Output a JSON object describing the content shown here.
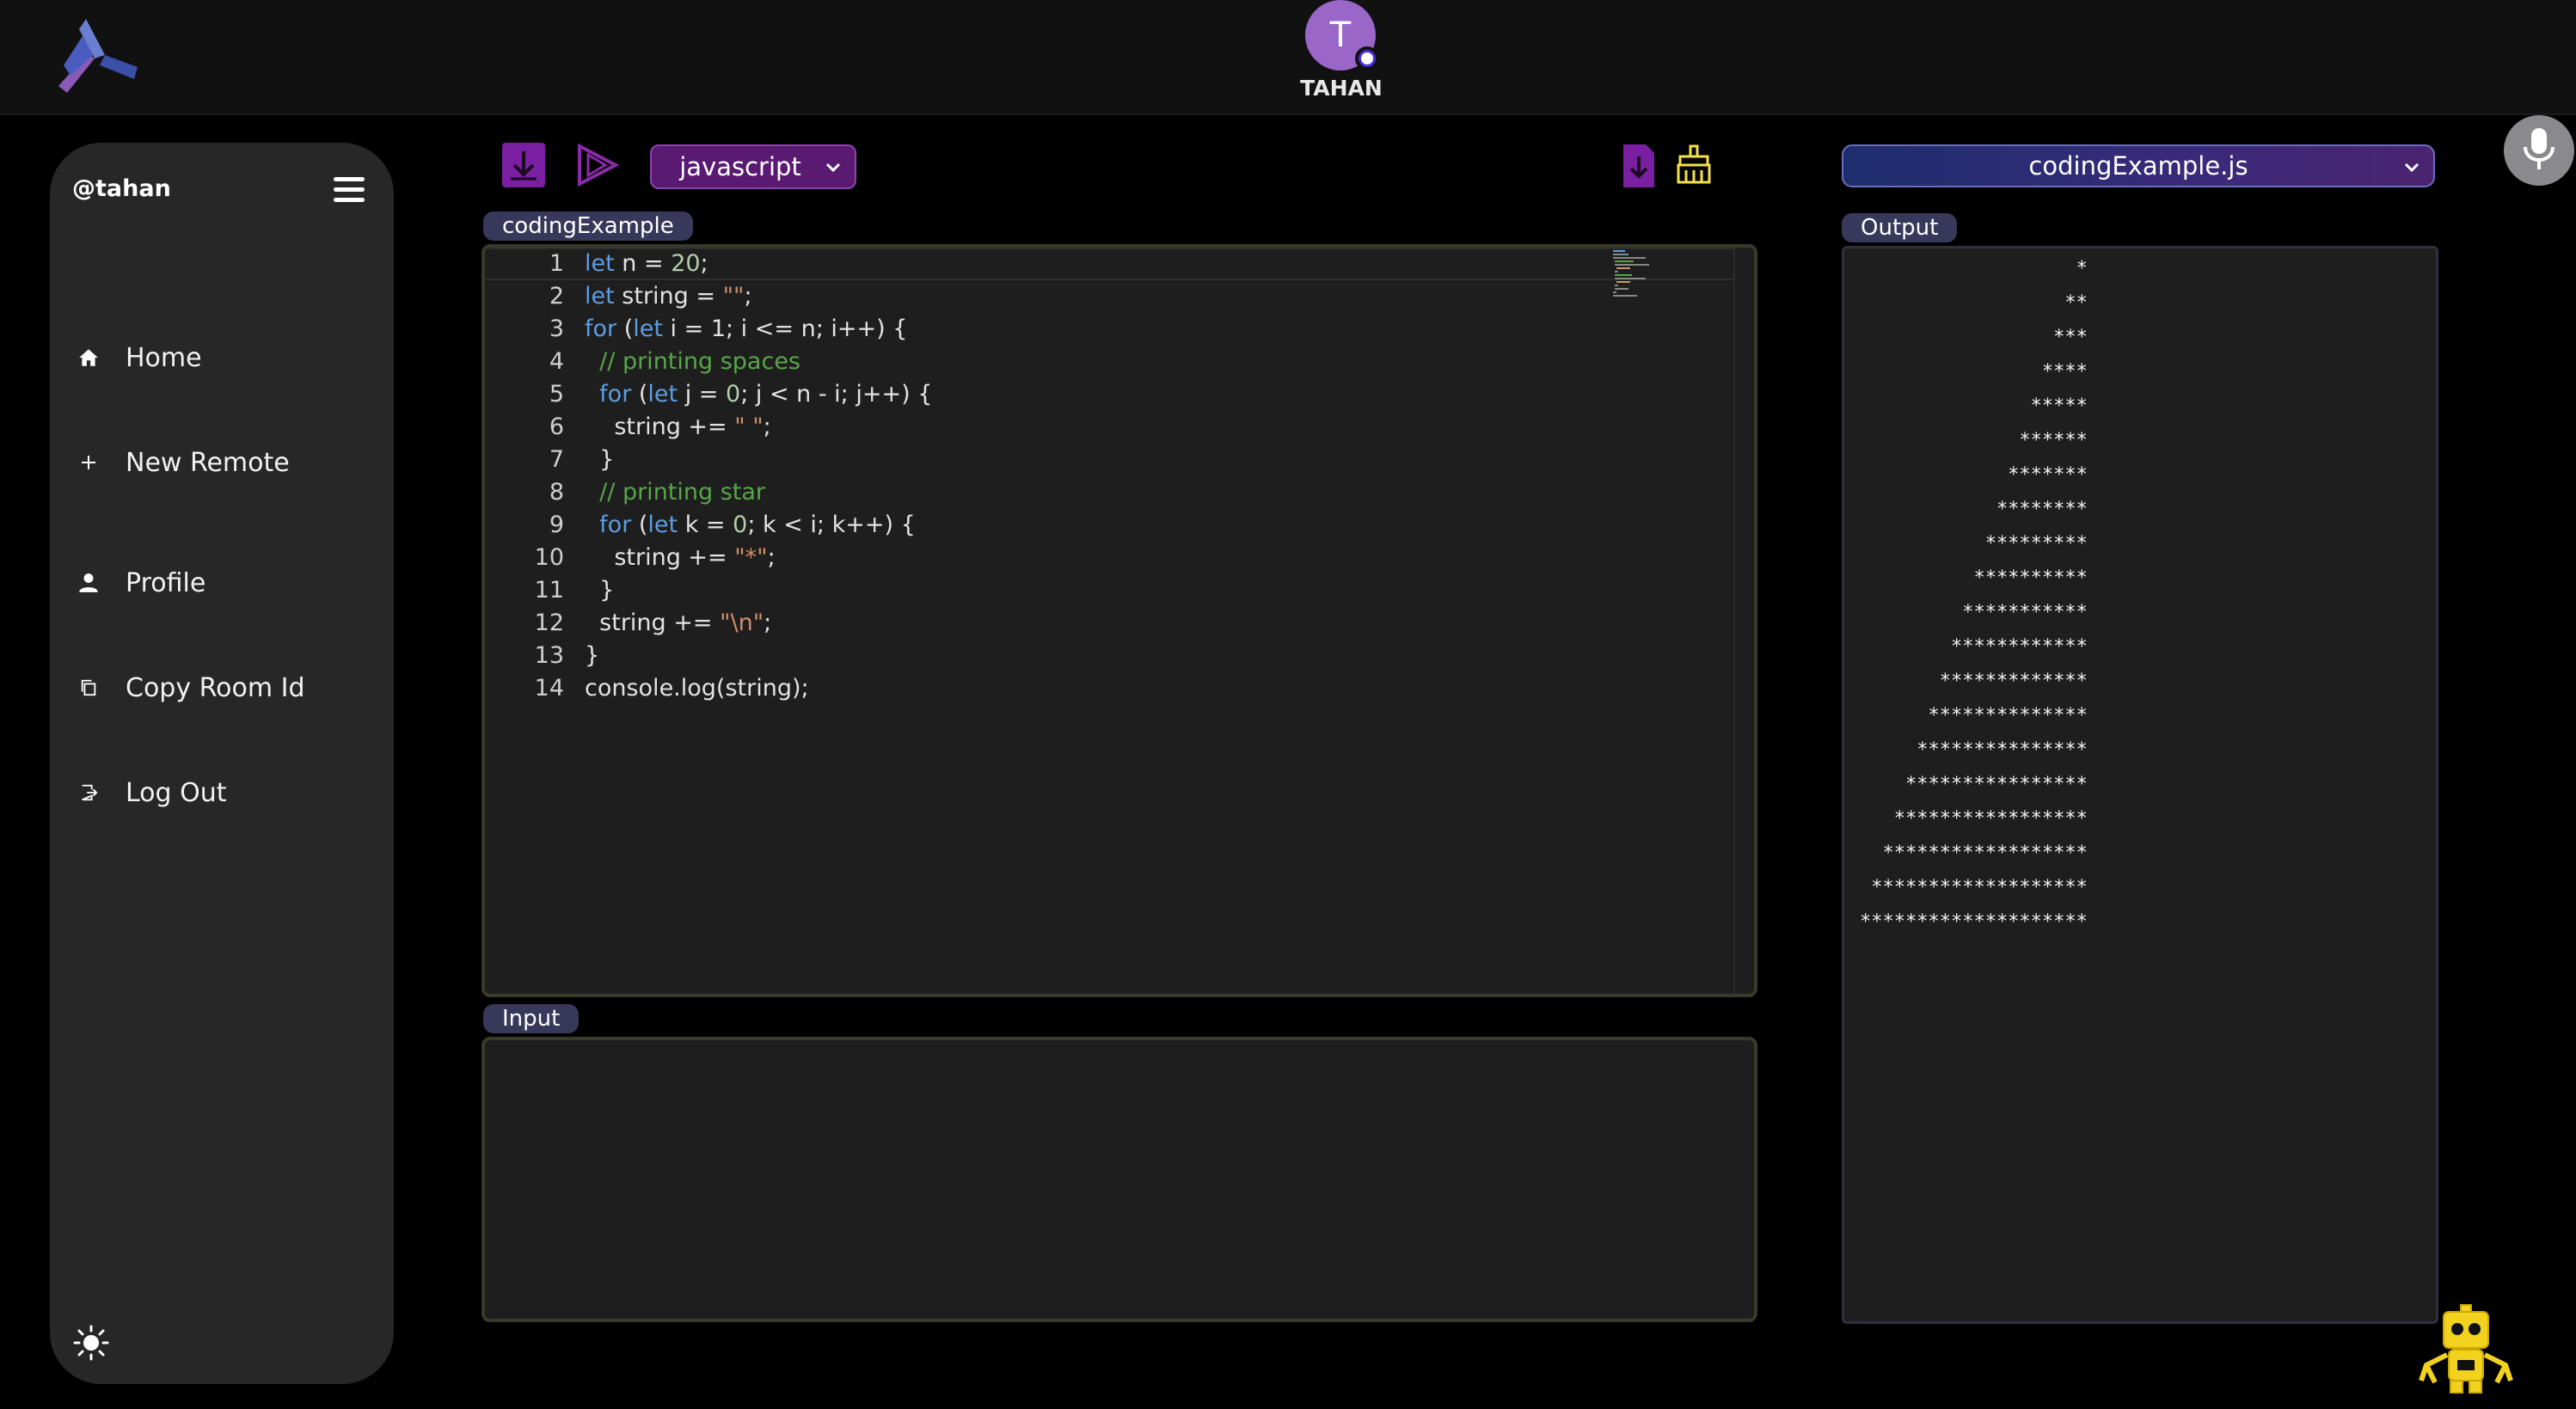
{
  "header": {
    "user_initial": "T",
    "user_name": "TAHAN"
  },
  "sidebar": {
    "handle": "@tahan",
    "items": [
      {
        "label": "Home",
        "icon": "home-icon"
      },
      {
        "label": "New Remote",
        "icon": "plus-icon"
      },
      {
        "label": "Profile",
        "icon": "user-icon"
      },
      {
        "label": "Copy Room Id",
        "icon": "copy-icon"
      },
      {
        "label": "Log Out",
        "icon": "logout-icon"
      }
    ],
    "theme_icon": "sun-icon"
  },
  "toolbar": {
    "language": "javascript",
    "file": "codingExample.js"
  },
  "editor": {
    "tab_label": "codingExample",
    "lines": [
      {
        "n": "1",
        "tokens": [
          [
            "kw",
            "let"
          ],
          [
            "pl",
            " n = "
          ],
          [
            "num",
            "20"
          ],
          [
            "pl",
            ";"
          ]
        ]
      },
      {
        "n": "2",
        "tokens": [
          [
            "kw",
            "let"
          ],
          [
            "pl",
            " string = "
          ],
          [
            "str",
            "\"\""
          ],
          [
            "pl",
            ";"
          ]
        ]
      },
      {
        "n": "3",
        "tokens": [
          [
            "kw",
            "for"
          ],
          [
            "pl",
            " ("
          ],
          [
            "kw",
            "let"
          ],
          [
            "pl",
            " i = 1; i <= n; i++) {"
          ]
        ]
      },
      {
        "n": "4",
        "tokens": [
          [
            "pl",
            "  "
          ],
          [
            "cm",
            "// printing spaces"
          ]
        ]
      },
      {
        "n": "5",
        "tokens": [
          [
            "pl",
            "  "
          ],
          [
            "kw",
            "for"
          ],
          [
            "pl",
            " ("
          ],
          [
            "kw",
            "let"
          ],
          [
            "pl",
            " j = "
          ],
          [
            "num",
            "0"
          ],
          [
            "pl",
            "; j < n - i; j++) {"
          ]
        ]
      },
      {
        "n": "6",
        "tokens": [
          [
            "pl",
            "    string += "
          ],
          [
            "str",
            "\" \""
          ],
          [
            "pl",
            ";"
          ]
        ]
      },
      {
        "n": "7",
        "tokens": [
          [
            "pl",
            "  }"
          ]
        ]
      },
      {
        "n": "8",
        "tokens": [
          [
            "pl",
            "  "
          ],
          [
            "cm",
            "// printing star"
          ]
        ]
      },
      {
        "n": "9",
        "tokens": [
          [
            "pl",
            "  "
          ],
          [
            "kw",
            "for"
          ],
          [
            "pl",
            " ("
          ],
          [
            "kw",
            "let"
          ],
          [
            "pl",
            " k = "
          ],
          [
            "num",
            "0"
          ],
          [
            "pl",
            "; k < i; k++) {"
          ]
        ]
      },
      {
        "n": "10",
        "tokens": [
          [
            "pl",
            "    string += "
          ],
          [
            "str",
            "\"*\""
          ],
          [
            "pl",
            ";"
          ]
        ]
      },
      {
        "n": "11",
        "tokens": [
          [
            "pl",
            "  }"
          ]
        ]
      },
      {
        "n": "12",
        "tokens": [
          [
            "pl",
            "  string += "
          ],
          [
            "str",
            "\"\\n\""
          ],
          [
            "pl",
            ";"
          ]
        ]
      },
      {
        "n": "13",
        "tokens": [
          [
            "pl",
            "}"
          ]
        ]
      },
      {
        "n": "14",
        "tokens": [
          [
            "pl",
            "console.log(string);"
          ]
        ]
      }
    ]
  },
  "input": {
    "tab_label": "Input",
    "value": ""
  },
  "output": {
    "tab_label": "Output",
    "lines": [
      "                   *",
      "                  **",
      "                 ***",
      "                ****",
      "               *****",
      "              ******",
      "             *******",
      "            ********",
      "           *********",
      "          **********",
      "         ***********",
      "        ************",
      "       *************",
      "      **************",
      "     ***************",
      "    ****************",
      "   *****************",
      "  ******************",
      " *******************",
      "********************"
    ]
  },
  "colors": {
    "accent_purple": "#7b1fa2",
    "toolbar_yellow": "#f4e04d",
    "robot_yellow": "#f2d21f"
  }
}
